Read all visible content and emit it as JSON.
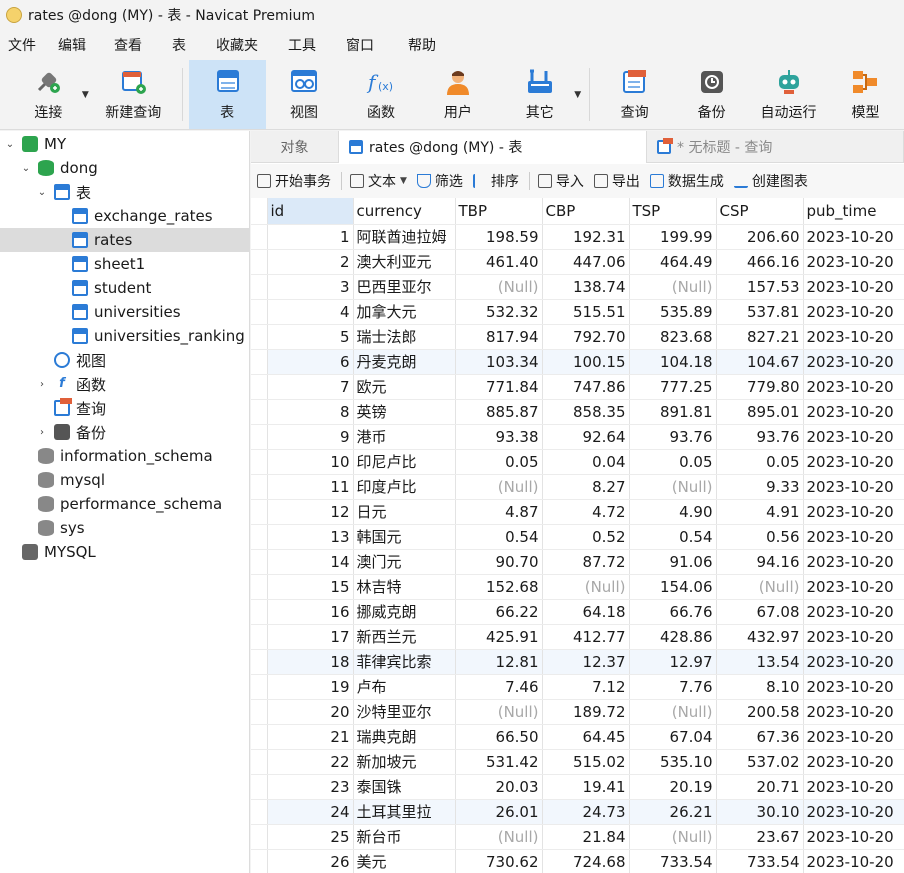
{
  "window": {
    "title": "rates @dong (MY) - 表 - Navicat Premium"
  },
  "menu": [
    "文件",
    "编辑",
    "查看",
    "表",
    "收藏夹",
    "工具",
    "窗口",
    "帮助"
  ],
  "toolbar": {
    "connect": "连接",
    "new_query": "新建查询",
    "table": "表",
    "view": "视图",
    "function": "函数",
    "user": "用户",
    "other": "其它",
    "query": "查询",
    "backup": "备份",
    "automation": "自动运行",
    "model": "模型"
  },
  "tree": {
    "conn_my": "MY",
    "db_dong": "dong",
    "tables_group": "表",
    "tables": [
      "exchange_rates",
      "rates",
      "sheet1",
      "student",
      "universities",
      "universities_ranking"
    ],
    "views_group": "视图",
    "functions_group": "函数",
    "queries_group": "查询",
    "backups_group": "备份",
    "other_dbs": [
      "information_schema",
      "mysql",
      "performance_schema",
      "sys"
    ],
    "conn_mysql": "MYSQL"
  },
  "tabs": {
    "objects": "对象",
    "rates": "rates @dong (MY) - 表",
    "untitled": "* 无标题 - 查询"
  },
  "subtoolbar": {
    "begin_tx": "开始事务",
    "text": "文本",
    "filter": "筛选",
    "sort": "排序",
    "import": "导入",
    "export": "导出",
    "gen_data": "数据生成",
    "create_chart": "创建图表"
  },
  "grid": {
    "columns": [
      "id",
      "currency",
      "TBP",
      "CBP",
      "TSP",
      "CSP",
      "pub_time"
    ],
    "rows": [
      [
        "1",
        "阿联酋迪拉姆",
        "198.59",
        "192.31",
        "199.99",
        "206.60",
        "2023-10-20"
      ],
      [
        "2",
        "澳大利亚元",
        "461.40",
        "447.06",
        "464.49",
        "466.16",
        "2023-10-20"
      ],
      [
        "3",
        "巴西里亚尔",
        "(Null)",
        "138.74",
        "(Null)",
        "157.53",
        "2023-10-20"
      ],
      [
        "4",
        "加拿大元",
        "532.32",
        "515.51",
        "535.89",
        "537.81",
        "2023-10-20"
      ],
      [
        "5",
        "瑞士法郎",
        "817.94",
        "792.70",
        "823.68",
        "827.21",
        "2023-10-20"
      ],
      [
        "6",
        "丹麦克朗",
        "103.34",
        "100.15",
        "104.18",
        "104.67",
        "2023-10-20"
      ],
      [
        "7",
        "欧元",
        "771.84",
        "747.86",
        "777.25",
        "779.80",
        "2023-10-20"
      ],
      [
        "8",
        "英镑",
        "885.87",
        "858.35",
        "891.81",
        "895.01",
        "2023-10-20"
      ],
      [
        "9",
        "港币",
        "93.38",
        "92.64",
        "93.76",
        "93.76",
        "2023-10-20"
      ],
      [
        "10",
        "印尼卢比",
        "0.05",
        "0.04",
        "0.05",
        "0.05",
        "2023-10-20"
      ],
      [
        "11",
        "印度卢比",
        "(Null)",
        "8.27",
        "(Null)",
        "9.33",
        "2023-10-20"
      ],
      [
        "12",
        "日元",
        "4.87",
        "4.72",
        "4.90",
        "4.91",
        "2023-10-20"
      ],
      [
        "13",
        "韩国元",
        "0.54",
        "0.52",
        "0.54",
        "0.56",
        "2023-10-20"
      ],
      [
        "14",
        "澳门元",
        "90.70",
        "87.72",
        "91.06",
        "94.16",
        "2023-10-20"
      ],
      [
        "15",
        "林吉特",
        "152.68",
        "(Null)",
        "154.06",
        "(Null)",
        "2023-10-20"
      ],
      [
        "16",
        "挪威克朗",
        "66.22",
        "64.18",
        "66.76",
        "67.08",
        "2023-10-20"
      ],
      [
        "17",
        "新西兰元",
        "425.91",
        "412.77",
        "428.86",
        "432.97",
        "2023-10-20"
      ],
      [
        "18",
        "菲律宾比索",
        "12.81",
        "12.37",
        "12.97",
        "13.54",
        "2023-10-20"
      ],
      [
        "19",
        "卢布",
        "7.46",
        "7.12",
        "7.76",
        "8.10",
        "2023-10-20"
      ],
      [
        "20",
        "沙特里亚尔",
        "(Null)",
        "189.72",
        "(Null)",
        "200.58",
        "2023-10-20"
      ],
      [
        "21",
        "瑞典克朗",
        "66.50",
        "64.45",
        "67.04",
        "67.36",
        "2023-10-20"
      ],
      [
        "22",
        "新加坡元",
        "531.42",
        "515.02",
        "535.10",
        "537.02",
        "2023-10-20"
      ],
      [
        "23",
        "泰国铢",
        "20.03",
        "19.41",
        "20.19",
        "20.71",
        "2023-10-20"
      ],
      [
        "24",
        "土耳其里拉",
        "26.01",
        "24.73",
        "26.21",
        "30.10",
        "2023-10-20"
      ],
      [
        "25",
        "新台币",
        "(Null)",
        "21.84",
        "(Null)",
        "23.67",
        "2023-10-20"
      ],
      [
        "26",
        "美元",
        "730.62",
        "724.68",
        "733.54",
        "733.54",
        "2023-10-20"
      ]
    ]
  }
}
